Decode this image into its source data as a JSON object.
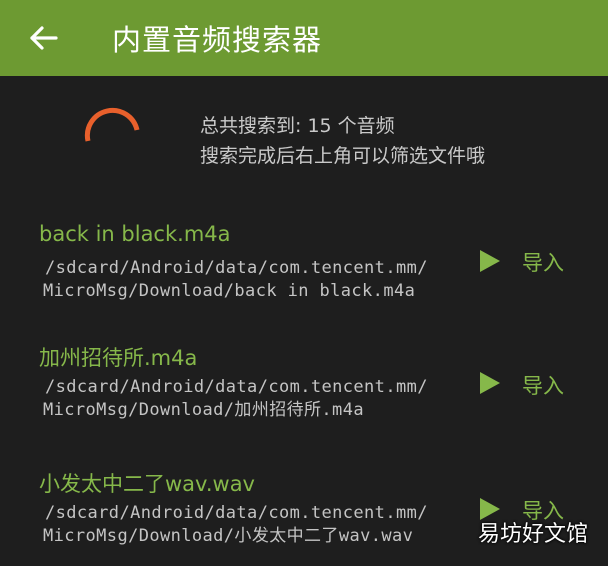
{
  "header": {
    "title": "内置音频搜索器",
    "back_icon": "arrow-left-icon"
  },
  "summary": {
    "line1": "总共搜索到: 15 个音频",
    "line2": "搜索完成后右上角可以筛选文件哦"
  },
  "colors": {
    "accent": "#6d9a32",
    "text_accent": "#86b84a",
    "spinner": "#e8602c",
    "background": "#1e1e1e"
  },
  "files": [
    {
      "name": "back in black.m4a",
      "path_line1": "/sdcard/Android/data/com.tencent.mm/",
      "path_line2": "MicroMsg/Download/back in black.m4a",
      "play_icon": "play-icon",
      "import_label": "导入"
    },
    {
      "name": "加州招待所.m4a",
      "path_line1": "/sdcard/Android/data/com.tencent.mm/",
      "path_line2": "MicroMsg/Download/加州招待所.m4a",
      "play_icon": "play-icon",
      "import_label": "导入"
    },
    {
      "name": "小发太中二了wav.wav",
      "path_line1": "/sdcard/Android/data/com.tencent.mm/",
      "path_line2": "MicroMsg/Download/小发太中二了wav.wav",
      "play_icon": "play-icon",
      "import_label": "导入"
    }
  ],
  "watermark": "易坊好文馆"
}
